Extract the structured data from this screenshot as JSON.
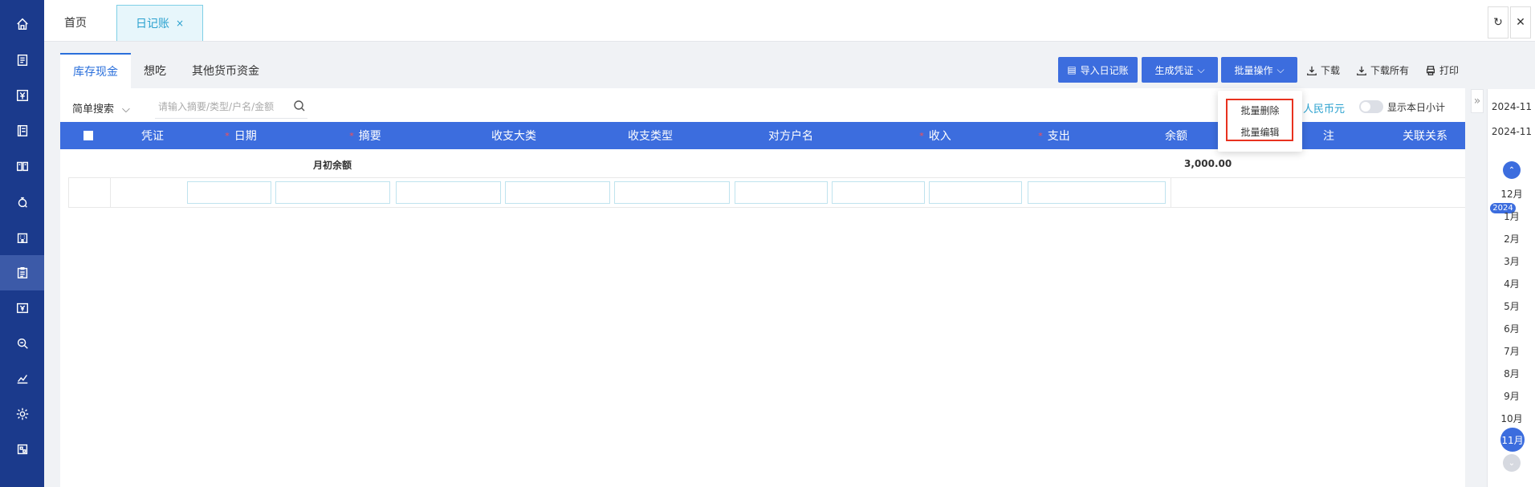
{
  "tabs": {
    "home": "首页",
    "active": "日记账",
    "close": "×"
  },
  "window_controls": {
    "refresh": "↻",
    "close": "✕"
  },
  "subtabs": [
    "库存现金",
    "想吃",
    "其他货币资金"
  ],
  "toolbar": {
    "import_label": "导入日记账",
    "voucher_label": "生成凭证",
    "batch_label": "批量操作",
    "download_label": "下载",
    "download_all_label": "下载所有",
    "print_label": "打印"
  },
  "batch_menu": [
    "批量删除",
    "批量编辑"
  ],
  "search": {
    "mode": "简单搜索",
    "placeholder": "请输入摘要/类型/户名/金额"
  },
  "currency": "人民币元",
  "show_daily_subtotal": "显示本日小计",
  "table": {
    "headers": [
      "凭证",
      "日期",
      "摘要",
      "收支大类",
      "收支类型",
      "对方户名",
      "收入",
      "支出",
      "余额",
      "注",
      "关联关系"
    ],
    "required": [
      "日期",
      "摘要",
      "收入",
      "支出"
    ],
    "opening_label": "月初余额",
    "opening_balance": "3,000.00"
  },
  "period_rail": {
    "periods": [
      "2024-11",
      "2024-11"
    ],
    "year_badge": "2024",
    "months": [
      "12月",
      "1月",
      "2月",
      "3月",
      "4月",
      "5月",
      "6月",
      "7月",
      "8月",
      "9月",
      "10月"
    ],
    "current_month": "11月"
  },
  "colors": {
    "nav_bg": "#1b3a8c",
    "primary": "#3c6dde",
    "highlight": "#e8321f",
    "tab_accent": "#2aa1cf"
  },
  "nav_icons": [
    "home-icon",
    "voucher-icon",
    "yuan-icon",
    "ledger-icon",
    "books-icon",
    "assets-icon",
    "building-icon",
    "journal-icon",
    "tax-icon",
    "search-report-icon",
    "chart-icon",
    "settings-icon",
    "tools-icon"
  ]
}
